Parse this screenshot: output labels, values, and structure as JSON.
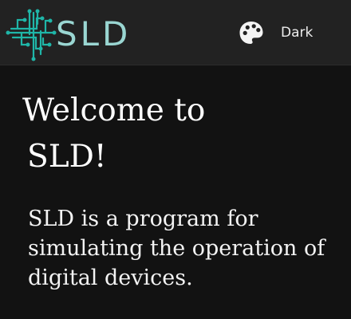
{
  "header": {
    "logo_text": "SLD",
    "theme_button": {
      "label": "Dark",
      "icon": "palette-icon"
    }
  },
  "main": {
    "title_line1": "Welcome to",
    "title_line2": "SLD!",
    "description": "SLD is a program for simulating the operation of digital devices."
  },
  "colors": {
    "header_background": "#222222",
    "page_background": "#121212",
    "logo_teal": "#9ad6d2",
    "logo_circuit": "#1fb6a8",
    "text": "#f2f2f2"
  }
}
